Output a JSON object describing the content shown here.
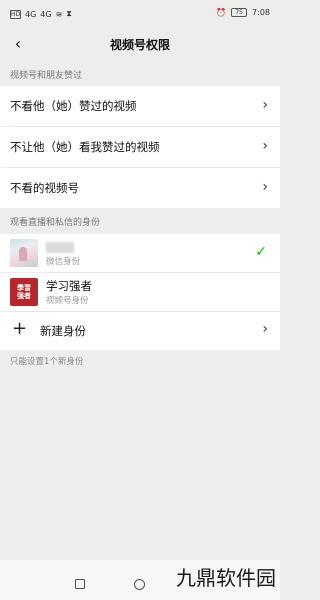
{
  "status_bar": {
    "left_icons": [
      "HD",
      "4G",
      "4G",
      "wifi",
      "hourglass"
    ],
    "time": "7:08",
    "battery": "75"
  },
  "nav": {
    "title": "视频号权限"
  },
  "section1": {
    "header": "视频号和朋友赞过",
    "items": [
      {
        "label": "不看他（她）赞过的视频"
      },
      {
        "label": "不让他（她）看我赞过的视频"
      },
      {
        "label": "不看的视频号"
      }
    ]
  },
  "section2": {
    "header": "观看直播和私信的身份",
    "identities": [
      {
        "name": "",
        "subtitle": "微信身份",
        "selected": true
      },
      {
        "name": "学习强者",
        "subtitle": "视频号身份",
        "avatar_text": "学習强者",
        "selected": false
      }
    ],
    "new_identity": "新建身份",
    "footer_note": "只能设置1个新身份"
  },
  "watermark": "九鼎软件园",
  "colors": {
    "check_green": "#09bb07",
    "avatar_red": "#b3282c",
    "background": "#ededed"
  }
}
